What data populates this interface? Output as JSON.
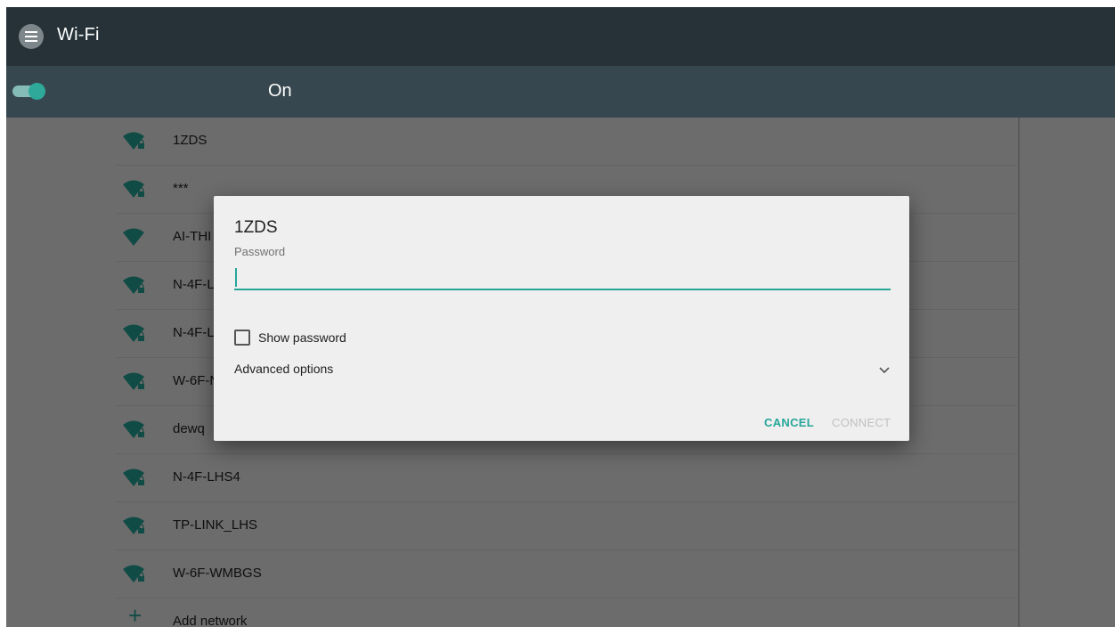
{
  "header": {
    "title": "Wi-Fi",
    "menu_icon": "menu-icon"
  },
  "switch_bar": {
    "state_label": "On",
    "toggle_on": true,
    "accent_color": "#26a69a"
  },
  "networks": [
    {
      "name": "1ZDS",
      "secured": true
    },
    {
      "name": "***",
      "secured": true
    },
    {
      "name": "AI-THI",
      "secured": false
    },
    {
      "name": "N-4F-L",
      "secured": true
    },
    {
      "name": "N-4F-L",
      "secured": true
    },
    {
      "name": "W-6F-N",
      "secured": true
    },
    {
      "name": "dewq",
      "secured": true
    },
    {
      "name": "N-4F-LHS4",
      "secured": true
    },
    {
      "name": "TP-LINK_LHS",
      "secured": true
    },
    {
      "name": "W-6F-WMBGS",
      "secured": true
    }
  ],
  "add_network": {
    "label": "Add network"
  },
  "dialog": {
    "title": "1ZDS",
    "password_label": "Password",
    "password_value": "",
    "show_password_label": "Show password",
    "show_password_checked": false,
    "advanced_label": "Advanced options",
    "cancel_label": "CANCEL",
    "connect_label": "CONNECT",
    "connect_enabled": false
  }
}
